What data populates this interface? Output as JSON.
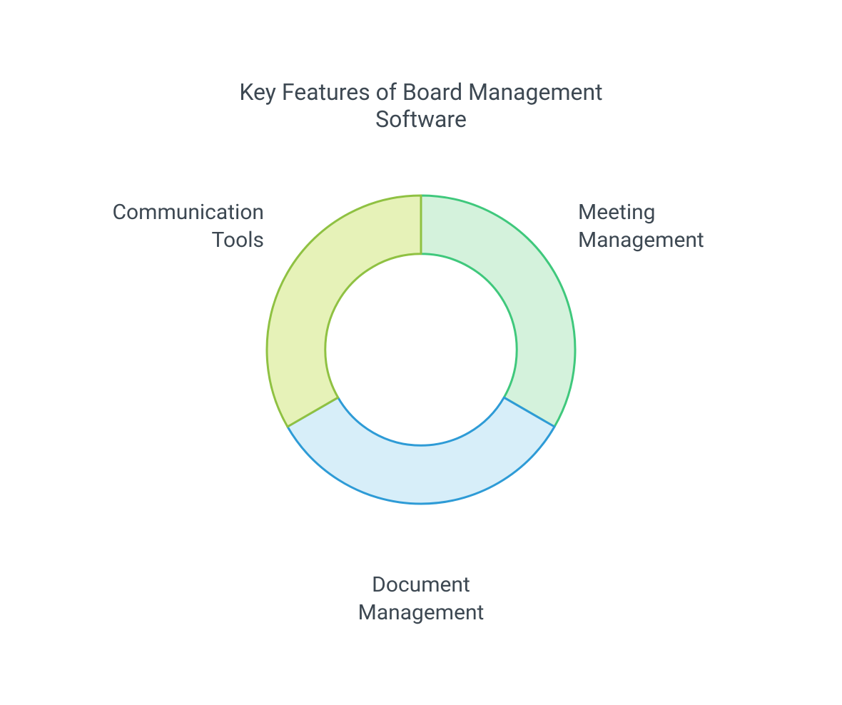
{
  "chart_data": {
    "type": "pie",
    "title": "Key Features of Board Management Software",
    "categories": [
      "Meeting Management",
      "Document Management",
      "Communication Tools"
    ],
    "values": [
      33.33,
      33.33,
      33.33
    ],
    "series": [
      {
        "name": "Meeting Management",
        "value": 33.33,
        "fill": "#d4f2dc",
        "stroke": "#3fc87c"
      },
      {
        "name": "Document Management",
        "value": 33.33,
        "fill": "#d7eef9",
        "stroke": "#2e9bd6"
      },
      {
        "name": "Communication Tools",
        "value": 33.33,
        "fill": "#e6f2b8",
        "stroke": "#8fc142"
      }
    ]
  },
  "labels": {
    "meeting_l1": "Meeting",
    "meeting_l2": "Management",
    "document_l1": "Document",
    "document_l2": "Management",
    "communication_l1": "Communication",
    "communication_l2": "Tools"
  }
}
